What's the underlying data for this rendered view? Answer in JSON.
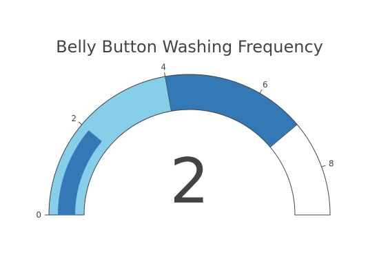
{
  "chart_data": {
    "type": "gauge",
    "title": "Belly Button Washing Frequency",
    "value": 2,
    "axis_range": [
      0,
      9
    ],
    "tick_values": [
      0,
      2,
      4,
      6,
      8
    ],
    "tick_labels": [
      "0",
      "2",
      "4",
      "6",
      "8"
    ],
    "steps": [
      {
        "range": [
          0,
          4
        ],
        "color": "#87ceeb"
      },
      {
        "range": [
          4,
          7
        ],
        "color": "#3379b5"
      }
    ],
    "bar": {
      "value": 2,
      "color": "#3379b5"
    },
    "background_color": "#ffffff",
    "border_color": "#444444"
  }
}
